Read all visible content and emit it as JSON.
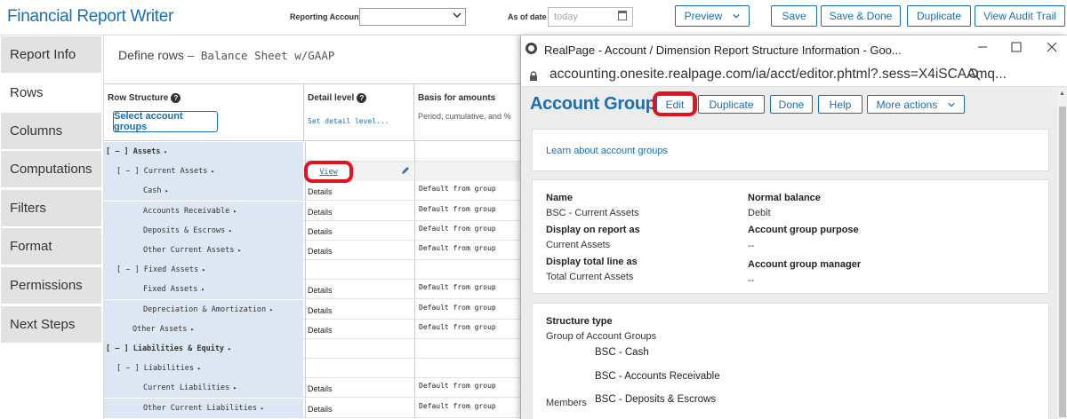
{
  "header": {
    "app_title": "Financial Report Writer",
    "reporting_accounts_label": "Reporting Accounts",
    "reporting_accounts_value": "",
    "as_of_date_label": "As of date",
    "as_of_date_placeholder": "today",
    "buttons": {
      "preview": "Preview",
      "save": "Save",
      "save_done": "Save & Done",
      "duplicate": "Duplicate",
      "audit": "View Audit Trail"
    }
  },
  "nav": {
    "items": [
      {
        "label": "Report Info",
        "active": false
      },
      {
        "label": "Rows",
        "active": true
      },
      {
        "label": "Columns",
        "active": false
      },
      {
        "label": "Computations",
        "active": false
      },
      {
        "label": "Filters",
        "active": false
      },
      {
        "label": "Format",
        "active": false
      },
      {
        "label": "Permissions",
        "active": false
      },
      {
        "label": "Next Steps",
        "active": false
      }
    ]
  },
  "main": {
    "title": "Define rows",
    "subtitle": "— Balance Sheet w/GAAP",
    "columns": {
      "row_structure": "Row Structure",
      "select_groups_button": "Select account groups",
      "detail_level": "Detail level",
      "detail_level_hint": "Set detail level...",
      "basis": "Basis for amounts",
      "basis_hint": "Period, cumulative, and %"
    },
    "view_link": "View",
    "rows": [
      {
        "label": "[ − ] Assets",
        "indent": 0,
        "group": true,
        "detail": "",
        "basis": ""
      },
      {
        "label": "[ − ] Current Assets",
        "indent": 1,
        "group": false,
        "detail": "",
        "basis": "",
        "highlight": true
      },
      {
        "label": "Cash",
        "indent": 3,
        "group": false,
        "detail": "Details",
        "basis": "Default from group"
      },
      {
        "label": "Accounts Receivable",
        "indent": 3,
        "group": false,
        "detail": "Details",
        "basis": "Default from group"
      },
      {
        "label": "Deposits & Escrows",
        "indent": 3,
        "group": false,
        "detail": "Details",
        "basis": "Default from group"
      },
      {
        "label": "Other Current Assets",
        "indent": 3,
        "group": false,
        "detail": "Details",
        "basis": "Default from group"
      },
      {
        "label": "[ − ] Fixed Assets",
        "indent": 1,
        "group": false,
        "detail": "",
        "basis": ""
      },
      {
        "label": "Fixed Assets",
        "indent": 3,
        "group": false,
        "detail": "Details",
        "basis": "Default from group"
      },
      {
        "label": "Depreciation & Amortization",
        "indent": 3,
        "group": false,
        "detail": "Details",
        "basis": "Default from group"
      },
      {
        "label": "Other Assets",
        "indent": 2,
        "group": false,
        "detail": "Details",
        "basis": "Default from group"
      },
      {
        "label": "[ − ] Liabilities & Equity",
        "indent": 0,
        "group": true,
        "detail": "",
        "basis": ""
      },
      {
        "label": "[ − ] Liabilities",
        "indent": 1,
        "group": false,
        "detail": "",
        "basis": ""
      },
      {
        "label": "Current Liabilities",
        "indent": 3,
        "group": false,
        "detail": "Details",
        "basis": "Default from group"
      },
      {
        "label": "Other Current Liabilities",
        "indent": 3,
        "group": false,
        "detail": "Details",
        "basis": "Default from group"
      }
    ]
  },
  "popup": {
    "window_title": "RealPage - Account / Dimension Report Structure Information - Goo...",
    "url": "accounting.onesite.realpage.com/ia/acct/editor.phtml?.sess=X4iSCAAmq...",
    "heading": "Account Group",
    "buttons": {
      "edit": "Edit",
      "duplicate": "Duplicate",
      "done": "Done",
      "help": "Help",
      "more": "More actions"
    },
    "learn_link": "Learn about account groups",
    "fields": {
      "name_label": "Name",
      "name_value": "BSC - Current Assets",
      "display_label": "Display on report as",
      "display_value": "Current Assets",
      "total_label": "Display total line as",
      "total_value": "Total Current Assets",
      "normal_label": "Normal balance",
      "normal_value": "Debit",
      "purpose_label": "Account group purpose",
      "purpose_value": "--",
      "manager_label": "Account group manager",
      "manager_value": "--"
    },
    "structure": {
      "type_label": "Structure type",
      "type_value": "Group of Account Groups",
      "members_label": "Members",
      "members": [
        "BSC - Cash",
        "BSC - Accounts Receivable",
        "BSC - Deposits & Escrows"
      ]
    }
  },
  "colors": {
    "brand_blue": "#1a6fb3",
    "highlight_red": "#e0131e",
    "tree_bg": "#dde7f3",
    "nav_bg": "#e2e2e2"
  }
}
